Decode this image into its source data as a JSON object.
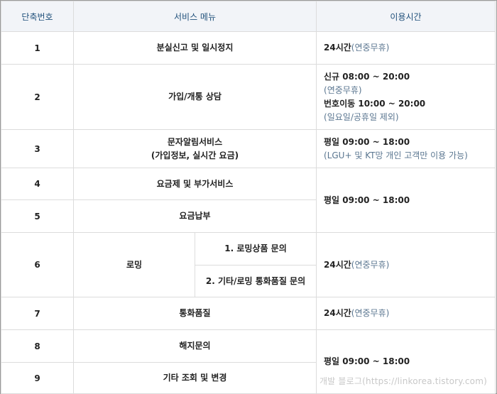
{
  "headers": {
    "col1": "단축번호",
    "col2": "서비스 메뉴",
    "col3": "이용시간"
  },
  "rows": {
    "r1": {
      "num": "1",
      "svc": "분실신고 및 일시정지",
      "time": "24시간",
      "note": "(연중무휴)"
    },
    "r2": {
      "num": "2",
      "svc": "가입/개통 상담",
      "t1": "신규 08:00 ~ 20:00",
      "n1": "(연중무휴)",
      "t2": "번호이동 10:00 ~ 20:00",
      "n2": "(일요일/공휴일 제외)"
    },
    "r3": {
      "num": "3",
      "svc1": "문자알림서비스",
      "svc2": "(가입정보, 실시간 요금)",
      "time": "평일 09:00 ~ 18:00",
      "note": "(LGU+ 및 KT망 개인 고객만 이용 가능)"
    },
    "r4": {
      "num": "4",
      "svc": "요금제 및 부가서비스",
      "time": "평일 09:00 ~ 18:00"
    },
    "r5": {
      "num": "5",
      "svc": "요금납부"
    },
    "r6": {
      "num": "6",
      "svc": "로밍",
      "sub1": "1. 로밍상품 문의",
      "sub2": "2. 기타/로밍 통화품질 문의",
      "time": "24시간",
      "note": "(연중무휴)"
    },
    "r7": {
      "num": "7",
      "svc": "통화품질",
      "time": "24시간",
      "note": "(연중무휴)"
    },
    "r8": {
      "num": "8",
      "svc": "해지문의",
      "time": "평일 09:00 ~ 18:00"
    },
    "r9": {
      "num": "9",
      "svc": "기타 조회 및 변경"
    }
  },
  "watermark": "개발 블로그(https://linkorea.tistory.com)"
}
